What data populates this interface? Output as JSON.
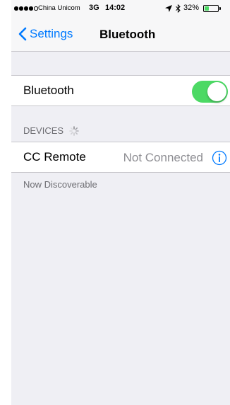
{
  "status_bar": {
    "carrier": "China Unicom",
    "network": "3G",
    "time": "14:02",
    "battery_percent": "32%",
    "battery_level": 0.32,
    "signal_bars_filled": 4,
    "signal_bars_total": 5
  },
  "nav": {
    "back_label": "Settings",
    "title": "Bluetooth"
  },
  "bluetooth_row": {
    "label": "Bluetooth",
    "enabled": true
  },
  "devices": {
    "header": "DEVICES",
    "items": [
      {
        "name": "CC Remote",
        "status": "Not Connected"
      }
    ]
  },
  "footer_text": "Now Discoverable",
  "colors": {
    "accent": "#007aff",
    "toggle_on": "#4cd964",
    "background": "#efeff4"
  },
  "icons": [
    "chevron-left-icon",
    "location-arrow-icon",
    "bluetooth-icon",
    "battery-icon",
    "activity-spinner-icon",
    "info-icon"
  ]
}
